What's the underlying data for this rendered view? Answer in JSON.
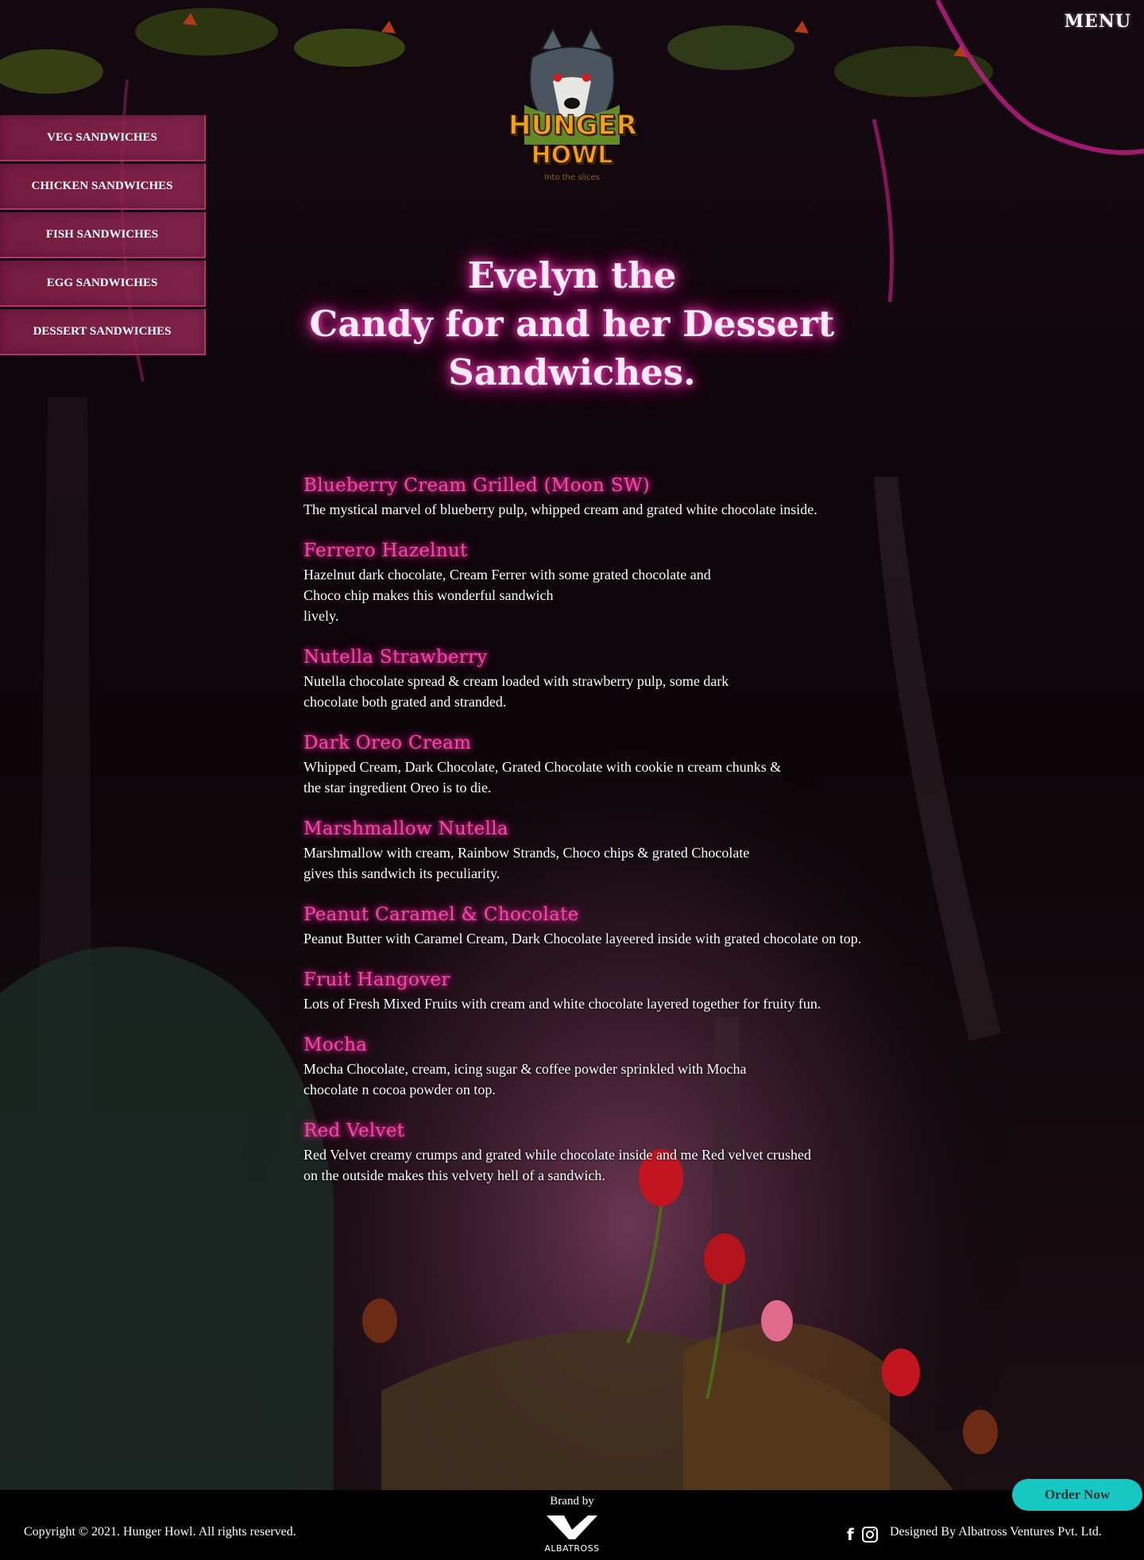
{
  "header": {
    "menu_label": "MENU",
    "logo": {
      "word_top": "HUNGER",
      "word_bottom": "HOWL",
      "tagline": "Into the slices"
    }
  },
  "side_nav": {
    "items": [
      {
        "label": "VEG SANDWICHES"
      },
      {
        "label": "CHICKEN SANDWICHES"
      },
      {
        "label": "FISH SANDWICHES"
      },
      {
        "label": "EGG SANDWICHES"
      },
      {
        "label": "DESSERT SANDWICHES"
      }
    ]
  },
  "hero": {
    "line1": "Evelyn the",
    "line2": "Candy for and her Dessert Sandwiches."
  },
  "menu_items": [
    {
      "name": "Blueberry Cream Grilled (Moon SW)",
      "description": "The mystical marvel of blueberry pulp, whipped cream and grated white chocolate inside."
    },
    {
      "name": "Ferrero Hazelnut",
      "description": "Hazelnut dark chocolate, Cream Ferrer with some grated chocolate and\nChoco chip makes this wonderful sandwich\nlively."
    },
    {
      "name": "Nutella Strawberry",
      "description": "Nutella chocolate spread & cream loaded with strawberry pulp, some dark\nchocolate both grated and stranded."
    },
    {
      "name": "Dark Oreo Cream",
      "description": "Whipped Cream, Dark Chocolate, Grated Chocolate with cookie n cream chunks &\nthe star ingredient Oreo is to die."
    },
    {
      "name": "Marshmallow Nutella",
      "description": "Marshmallow with cream, Rainbow Strands, Choco chips & grated Chocolate\ngives this sandwich its peculiarity."
    },
    {
      "name": "Peanut Caramel & Chocolate",
      "description": "Peanut Butter with Caramel Cream, Dark Chocolate layeered inside with grated chocolate on top."
    },
    {
      "name": "Fruit Hangover",
      "description": "Lots of Fresh Mixed Fruits with cream and white chocolate layered together for fruity fun."
    },
    {
      "name": "Mocha",
      "description": "Mocha Chocolate, cream, icing sugar & coffee powder sprinkled with Mocha\nchocolate n cocoa powder on top."
    },
    {
      "name": "Red Velvet",
      "description": "Red Velvet creamy crumps and grated while chocolate inside and me Red velvet crushed\non the outside makes this velvety hell of a sandwich."
    }
  ],
  "order_button": {
    "label": "Order Now"
  },
  "footer": {
    "copyright": "Copyright © 2021. Hunger Howl. All rights reserved.",
    "brand_by": "Brand by",
    "brand_name": "ALBATROSS",
    "designed_by": "Designed By Albatross Ventures Pvt. Ltd.",
    "social": [
      "facebook-icon",
      "instagram-icon"
    ]
  },
  "colors": {
    "accent_pink": "#f04aa6",
    "nav_bg": "#8a2352",
    "order_button": "#17c7c1",
    "footer_bg": "#000000"
  }
}
